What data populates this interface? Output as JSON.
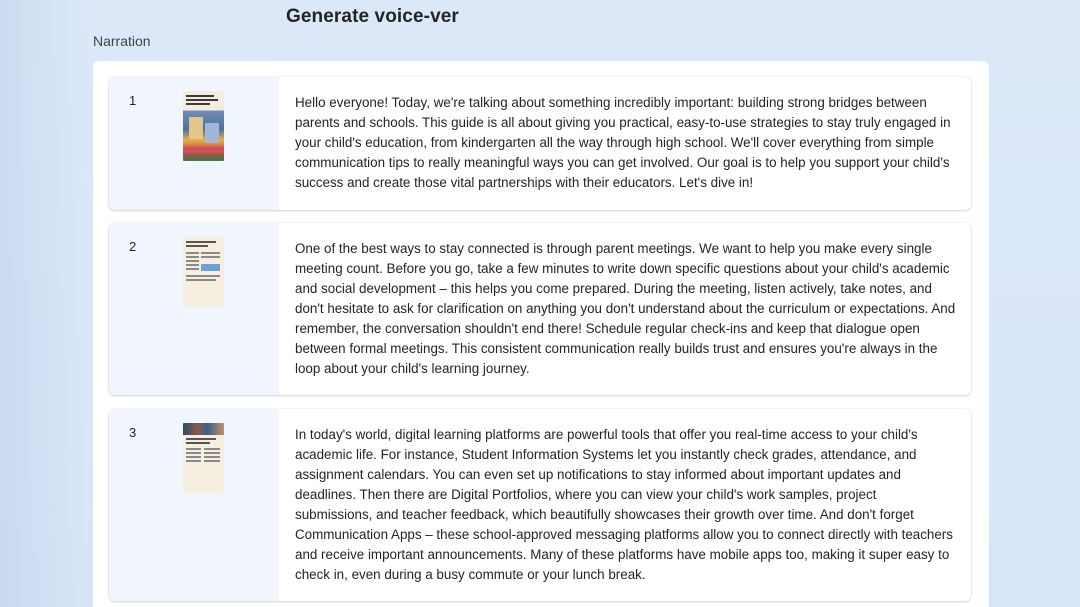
{
  "header": {
    "title": "Generate voice-ver"
  },
  "narration": {
    "label": "Narration",
    "items": [
      {
        "number": "1",
        "thumbnail": "slide-thumbnail-title",
        "text": "Hello everyone! Today, we're talking about something incredibly important: building strong bridges between parents and schools. This guide is all about giving you practical, easy-to-use strategies to stay truly engaged in your child's education, from kindergarten all the way through high school. We'll cover everything from simple communication tips to really meaningful ways you can get involved. Our goal is to help you support your child's success and create those vital partnerships with their educators. Let's dive in!"
      },
      {
        "number": "2",
        "thumbnail": "slide-thumbnail-meetings",
        "text": "One of the best ways to stay connected is through parent meetings. We want to help you make every single meeting count. Before you go, take a few minutes to write down specific questions about your child's academic and social development – this helps you come prepared. During the meeting, listen actively, take notes, and don't hesitate to ask for clarification on anything you don't understand about the curriculum or expectations. And remember, the conversation shouldn't end there! Schedule regular check-ins and keep that dialogue open between formal meetings. This consistent communication really builds trust and ensures you're always in the loop about your child's learning journey."
      },
      {
        "number": "3",
        "thumbnail": "slide-thumbnail-platforms",
        "text": "In today's world, digital learning platforms are powerful tools that offer you real-time access to your child's academic life. For instance, Student Information Systems let you instantly check grades, attendance, and assignment calendars. You can even set up notifications to stay informed about important updates and deadlines. Then there are Digital Portfolios, where you can view your child's work samples, project submissions, and teacher feedback, which beautifully showcases their growth over time. And don't forget Communication Apps – these school-approved messaging platforms allow you to connect directly with teachers and receive important announcements. Many of these platforms have mobile apps too, making it super easy to check in, even during a busy commute or your lunch break."
      }
    ]
  },
  "colors": {
    "page_background": "#dce8f8",
    "card_left_background": "#f0f5fe",
    "panel_background": "#ffffff"
  }
}
